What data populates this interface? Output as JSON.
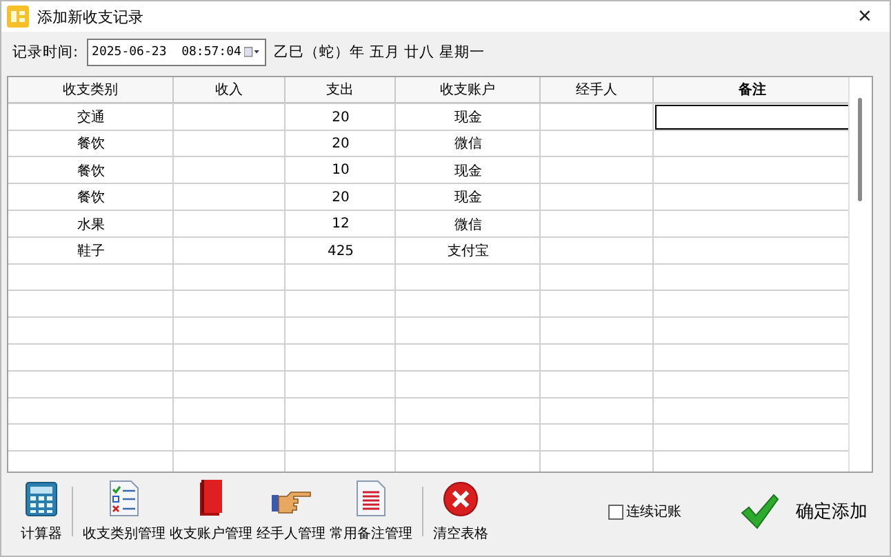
{
  "window": {
    "title": "添加新收支记录",
    "close": "×"
  },
  "record_time": {
    "label": "记录时间:",
    "value": "2025-06-23  08:57:04",
    "lunar": "乙巳（蛇）年 五月 廿八 星期一"
  },
  "table": {
    "columns": [
      "收支类别",
      "收入",
      "支出",
      "收支账户",
      "经手人",
      "备注"
    ],
    "rows": [
      {
        "category": "交通",
        "expense": "20",
        "account": "现金",
        "focused": true
      },
      {
        "category": "餐饮",
        "expense": "20",
        "account": "微信",
        "focused": false
      },
      {
        "category": "餐饮",
        "expense": "10",
        "account": "现金",
        "focused": false
      },
      {
        "category": "餐饮",
        "expense": "20",
        "account": "现金",
        "focused": false
      },
      {
        "category": "水果",
        "expense": "12",
        "account": "微信",
        "focused": false
      },
      {
        "category": "鞋子",
        "expense": "425",
        "account": "支付宝",
        "focused": false
      }
    ]
  },
  "toolbar": [
    {
      "kind": "calculator",
      "label": "计算器"
    },
    {
      "kind": "separator"
    },
    {
      "kind": "checklist",
      "label": "收支类别管理"
    },
    {
      "kind": "book",
      "label": "收支账户管理"
    },
    {
      "kind": "hand",
      "label": "经手人管理"
    },
    {
      "kind": "notes",
      "label": "常用备注管理"
    },
    {
      "kind": "separator"
    },
    {
      "kind": "clear",
      "label": "清空表格"
    }
  ],
  "continuous": {
    "label": "连续记账",
    "checked": false
  },
  "confirm": {
    "label": "确定添加"
  }
}
